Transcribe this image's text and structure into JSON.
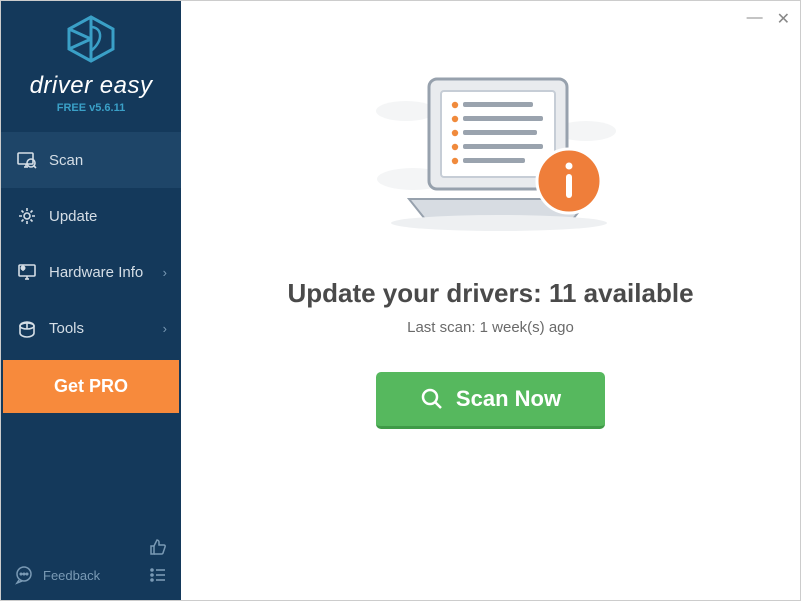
{
  "app": {
    "name": "driver easy",
    "version_label": "FREE v5.6.11"
  },
  "nav": {
    "scan": "Scan",
    "update": "Update",
    "hardware_info": "Hardware Info",
    "tools": "Tools"
  },
  "get_pro_label": "Get PRO",
  "footer": {
    "feedback_label": "Feedback"
  },
  "main": {
    "headline": "Update your drivers: 11 available",
    "subline": "Last scan: 1 week(s) ago",
    "scan_button": "Scan Now"
  }
}
